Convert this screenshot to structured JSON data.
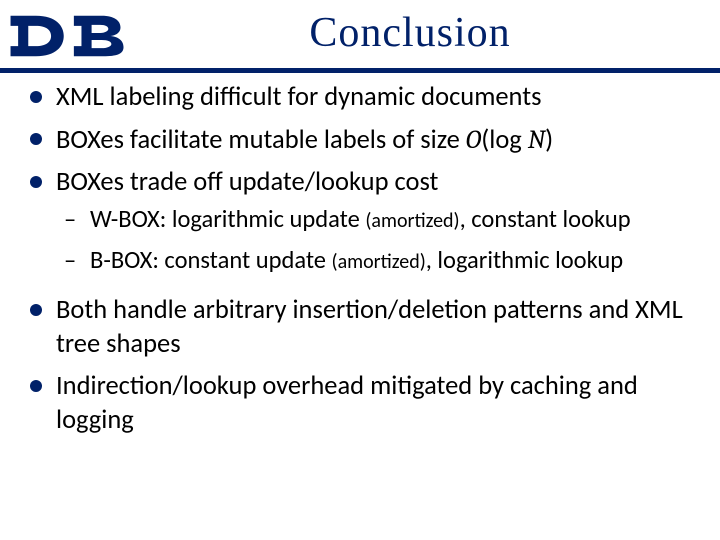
{
  "header": {
    "logo_name": "duke-logo",
    "title": "Conclusion"
  },
  "bullets": {
    "b0": "XML labeling difficult for dynamic documents",
    "b1_a": "BOXes facilitate mutable labels of size ",
    "b1_O": "O",
    "b1_b": "(log ",
    "b1_N": "N",
    "b1_c": ")",
    "b2": "BOXes trade off update/lookup cost",
    "b2s0_a": "W-BOX: logarithmic update ",
    "b2s0_am": "(amortized)",
    "b2s0_b": ", constant lookup",
    "b2s1_a": "B-BOX: constant update ",
    "b2s1_am": "(amortized)",
    "b2s1_b": ", logarithmic lookup",
    "b3": "Both handle arbitrary insertion/deletion patterns and XML tree shapes",
    "b4": "Indirection/lookup overhead mitigated by caching and logging"
  }
}
